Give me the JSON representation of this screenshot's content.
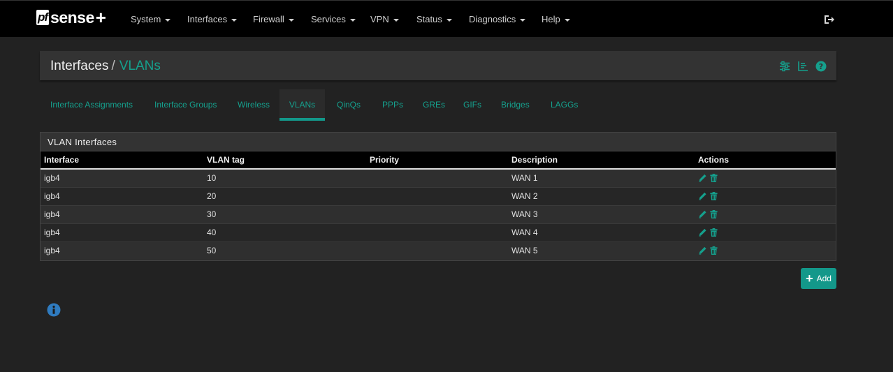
{
  "brand": {
    "prefix": "pf",
    "name": "sense",
    "suffix": "+"
  },
  "nav": {
    "items": [
      {
        "label": "System"
      },
      {
        "label": "Interfaces"
      },
      {
        "label": "Firewall"
      },
      {
        "label": "Services"
      },
      {
        "label": "VPN"
      },
      {
        "label": "Status"
      },
      {
        "label": "Diagnostics"
      },
      {
        "label": "Help"
      }
    ]
  },
  "breadcrumb": {
    "root": "Interfaces",
    "separator": "/",
    "current": "VLANs"
  },
  "tabs": [
    {
      "label": "Interface Assignments"
    },
    {
      "label": "Interface Groups"
    },
    {
      "label": "Wireless"
    },
    {
      "label": "VLANs",
      "active": true
    },
    {
      "label": "QinQs"
    },
    {
      "label": "PPPs"
    },
    {
      "label": "GREs"
    },
    {
      "label": "GIFs"
    },
    {
      "label": "Bridges"
    },
    {
      "label": "LAGGs"
    }
  ],
  "panel": {
    "title": "VLAN Interfaces",
    "columns": [
      "Interface",
      "VLAN tag",
      "Priority",
      "Description",
      "Actions"
    ],
    "rows": [
      {
        "interface": "igb4",
        "tag": "10",
        "priority": "",
        "description": "WAN 1"
      },
      {
        "interface": "igb4",
        "tag": "20",
        "priority": "",
        "description": "WAN 2"
      },
      {
        "interface": "igb4",
        "tag": "30",
        "priority": "",
        "description": "WAN 3"
      },
      {
        "interface": "igb4",
        "tag": "40",
        "priority": "",
        "description": "WAN 4"
      },
      {
        "interface": "igb4",
        "tag": "50",
        "priority": "",
        "description": "WAN 5"
      }
    ]
  },
  "add_button": {
    "label": "Add"
  },
  "colors": {
    "accent": "#13988a",
    "link": "#15a08d",
    "navbar": "#000000",
    "background": "#222222",
    "info": "#2f7bbf"
  }
}
